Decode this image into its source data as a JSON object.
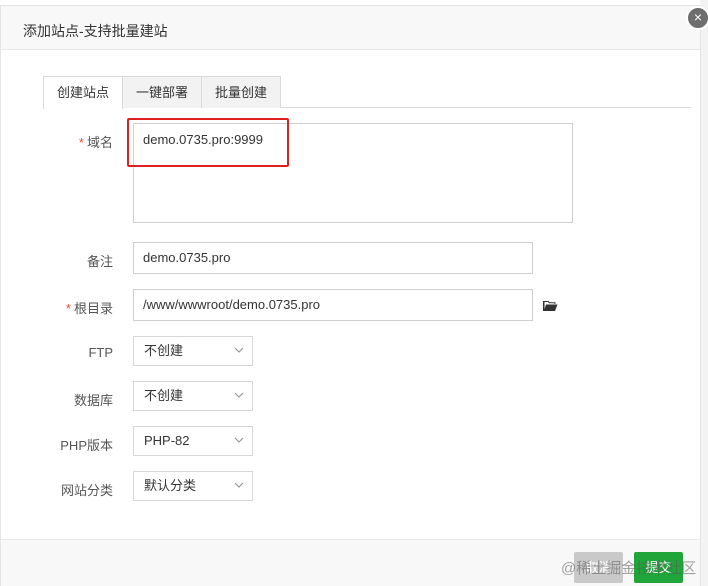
{
  "dialog": {
    "title": "添加站点-支持批量建站",
    "close_symbol": "×"
  },
  "tabs": [
    {
      "label": "创建站点",
      "active": true
    },
    {
      "label": "一键部署",
      "active": false
    },
    {
      "label": "批量创建",
      "active": false
    }
  ],
  "form": {
    "domain": {
      "label": "域名",
      "required_mark": "*",
      "value": "demo.0735.pro:9999"
    },
    "remark": {
      "label": "备注",
      "value": "demo.0735.pro"
    },
    "root": {
      "label": "根目录",
      "required_mark": "*",
      "value": "/www/wwwroot/demo.0735.pro"
    },
    "ftp": {
      "label": "FTP",
      "value": "不创建"
    },
    "database": {
      "label": "数据库",
      "value": "不创建"
    },
    "php": {
      "label": "PHP版本",
      "value": "PHP-82"
    },
    "category": {
      "label": "网站分类",
      "value": "默认分类"
    }
  },
  "footer": {
    "cancel_label": "取消",
    "submit_label": "提交",
    "watermark": "@稀土掘金技术社区"
  },
  "colors": {
    "required": "#e84c3d",
    "highlight": "#e02020",
    "submit": "#20a53a"
  },
  "icons": {
    "folder": "folder-open-icon",
    "close": "close-icon",
    "chevron": "chevron-down-icon"
  }
}
